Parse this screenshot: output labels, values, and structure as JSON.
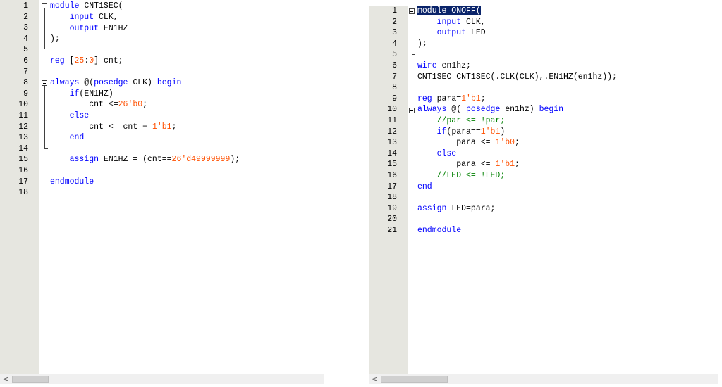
{
  "left_editor": {
    "line_numbers": [
      "1",
      "2",
      "3",
      "4",
      "5",
      "6",
      "7",
      "8",
      "9",
      "10",
      "11",
      "12",
      "13",
      "14",
      "15",
      "16",
      "17",
      "18"
    ],
    "lines": [
      [
        {
          "t": "module",
          "c": "kw"
        },
        {
          "t": " CNT1SEC(",
          "c": "tx"
        }
      ],
      [
        {
          "t": "    input",
          "c": "kw"
        },
        {
          "t": " CLK,",
          "c": "tx"
        }
      ],
      [
        {
          "t": "    output",
          "c": "kw"
        },
        {
          "t": " EN1HZ",
          "c": "tx"
        }
      ],
      [
        {
          "t": ");",
          "c": "tx"
        }
      ],
      [],
      [
        {
          "t": "reg",
          "c": "kw"
        },
        {
          "t": " [",
          "c": "tx"
        },
        {
          "t": "25",
          "c": "num"
        },
        {
          "t": ":",
          "c": "tx"
        },
        {
          "t": "0",
          "c": "num"
        },
        {
          "t": "] cnt;",
          "c": "tx"
        }
      ],
      [],
      [
        {
          "t": "always",
          "c": "kw"
        },
        {
          "t": " @(",
          "c": "tx"
        },
        {
          "t": "posedge",
          "c": "kw"
        },
        {
          "t": " CLK) ",
          "c": "tx"
        },
        {
          "t": "begin",
          "c": "kw"
        }
      ],
      [
        {
          "t": "    if",
          "c": "kw"
        },
        {
          "t": "(EN1HZ)",
          "c": "tx"
        }
      ],
      [
        {
          "t": "        cnt <=",
          "c": "tx"
        },
        {
          "t": "26'b0",
          "c": "num"
        },
        {
          "t": ";",
          "c": "tx"
        }
      ],
      [
        {
          "t": "    else",
          "c": "kw"
        }
      ],
      [
        {
          "t": "        cnt <= cnt + ",
          "c": "tx"
        },
        {
          "t": "1'b1",
          "c": "num"
        },
        {
          "t": ";",
          "c": "tx"
        }
      ],
      [
        {
          "t": "    end",
          "c": "kw"
        }
      ],
      [],
      [
        {
          "t": "    assign",
          "c": "kw"
        },
        {
          "t": " EN1HZ = (cnt==",
          "c": "tx"
        },
        {
          "t": "26'd49999999",
          "c": "num"
        },
        {
          "t": ");",
          "c": "tx"
        }
      ],
      [],
      [
        {
          "t": "endmodule",
          "c": "kw"
        }
      ],
      []
    ],
    "scroll_arrow": "<"
  },
  "right_editor": {
    "line_numbers": [
      "1",
      "2",
      "3",
      "4",
      "5",
      "6",
      "7",
      "8",
      "9",
      "10",
      "11",
      "12",
      "13",
      "14",
      "15",
      "16",
      "17",
      "18",
      "19",
      "20",
      "21"
    ],
    "lines": [
      [
        {
          "t": "module ONOFF(",
          "c": "sel"
        }
      ],
      [
        {
          "t": "    input",
          "c": "kw"
        },
        {
          "t": " CLK,",
          "c": "tx"
        }
      ],
      [
        {
          "t": "    output",
          "c": "kw"
        },
        {
          "t": " LED",
          "c": "tx"
        }
      ],
      [
        {
          "t": ");",
          "c": "tx"
        }
      ],
      [],
      [
        {
          "t": "wire",
          "c": "kw"
        },
        {
          "t": " en1hz;",
          "c": "tx"
        }
      ],
      [
        {
          "t": "CNT1SEC CNT1SEC(.CLK(CLK),.EN1HZ(en1hz));",
          "c": "tx"
        }
      ],
      [],
      [
        {
          "t": "reg",
          "c": "kw"
        },
        {
          "t": " para=",
          "c": "tx"
        },
        {
          "t": "1'b1",
          "c": "num"
        },
        {
          "t": ";",
          "c": "tx"
        }
      ],
      [
        {
          "t": "always",
          "c": "kw"
        },
        {
          "t": " @( ",
          "c": "tx"
        },
        {
          "t": "posedge",
          "c": "kw"
        },
        {
          "t": " en1hz) ",
          "c": "tx"
        },
        {
          "t": "begin",
          "c": "kw"
        }
      ],
      [
        {
          "t": "    //par <= !par;",
          "c": "cm"
        }
      ],
      [
        {
          "t": "    if",
          "c": "kw"
        },
        {
          "t": "(para==",
          "c": "tx"
        },
        {
          "t": "1'b1",
          "c": "num"
        },
        {
          "t": ")",
          "c": "tx"
        }
      ],
      [
        {
          "t": "        para <= ",
          "c": "tx"
        },
        {
          "t": "1'b0",
          "c": "num"
        },
        {
          "t": ";",
          "c": "tx"
        }
      ],
      [
        {
          "t": "    else",
          "c": "kw"
        }
      ],
      [
        {
          "t": "        para <= ",
          "c": "tx"
        },
        {
          "t": "1'b1",
          "c": "num"
        },
        {
          "t": ";",
          "c": "tx"
        }
      ],
      [
        {
          "t": "    //LED <= !LED;",
          "c": "cm"
        }
      ],
      [
        {
          "t": "end",
          "c": "kw"
        }
      ],
      [],
      [
        {
          "t": "assign",
          "c": "kw"
        },
        {
          "t": " LED=para;",
          "c": "tx"
        }
      ],
      [],
      [
        {
          "t": "endmodule",
          "c": "kw"
        }
      ]
    ],
    "scroll_arrow": "<"
  },
  "colors": {
    "keyword": "#0000ff",
    "number": "#ff5000",
    "comment": "#008000",
    "text": "#000000",
    "selection": "#0a246a",
    "gutter": "#e6e6e0"
  }
}
